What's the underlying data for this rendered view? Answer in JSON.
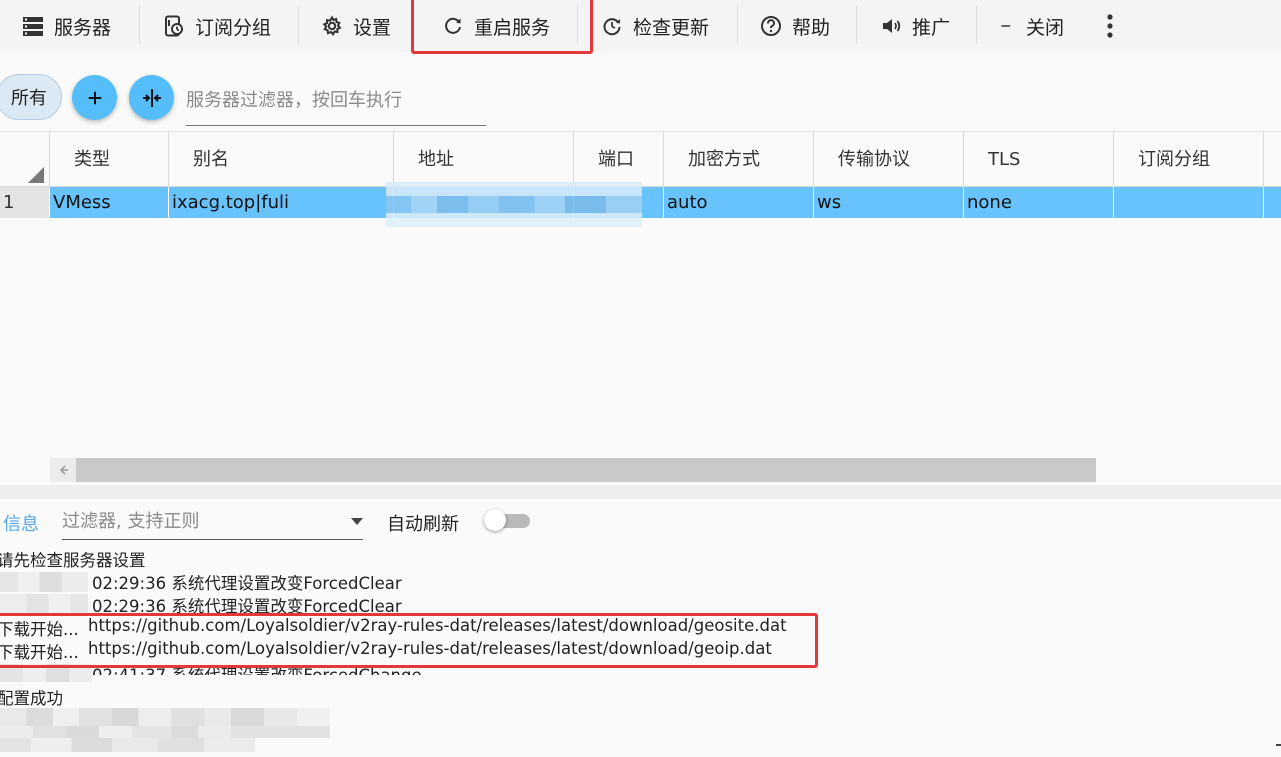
{
  "toolbar": {
    "servers": "服务器",
    "subscription_group": "订阅分组",
    "settings": "设置",
    "restart_service": "重启服务",
    "check_update": "检查更新",
    "help": "帮助",
    "promote": "推广",
    "close": "关闭"
  },
  "filter_row": {
    "all_label": "所有",
    "server_filter_placeholder": "服务器过滤器，按回车执行"
  },
  "table": {
    "columns": [
      "类型",
      "别名",
      "地址",
      "端口",
      "加密方式",
      "传输协议",
      "TLS",
      "订阅分组"
    ],
    "rows": [
      {
        "index": "1",
        "type": "VMess",
        "alias": "ixacg.top|fuli",
        "address": "",
        "port": "",
        "security": "auto",
        "network": "ws",
        "tls": "none",
        "sub_group": ""
      }
    ]
  },
  "log": {
    "tab_label": "信息",
    "filter_placeholder": "过滤器, 支持正则",
    "auto_refresh_label": "自动刷新",
    "auto_refresh_on": false,
    "lines": [
      "请先检查服务器设置",
      "02:29:36 系统代理设置改变ForcedClear",
      "02:29:36 系统代理设置改变ForcedClear",
      "下载开始...",
      "https://github.com/Loyalsoldier/v2ray-rules-dat/releases/latest/download/geosite.dat",
      "下载开始...",
      "https://github.com/Loyalsoldier/v2ray-rules-dat/releases/latest/download/geoip.dat",
      "02:41:37 系统代理设置改变ForcedChange",
      "配置成功"
    ]
  },
  "colors": {
    "accent": "#55bdfa",
    "selected_row": "#68c2fb",
    "highlight_box": "#e2383a",
    "info_tab": "#5aa8e6"
  }
}
